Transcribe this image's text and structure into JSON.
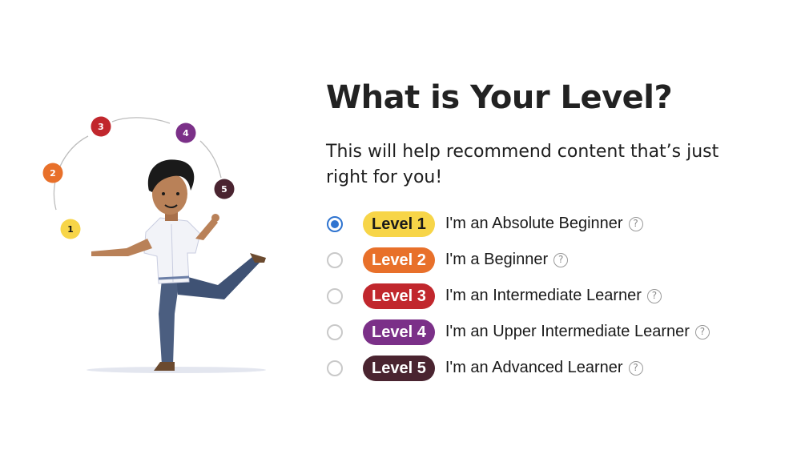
{
  "header": {
    "title": "What is Your Level?",
    "subtitle": "This will help recommend content that’s just right for you!"
  },
  "illustration": {
    "icon": "juggling-person-illustration",
    "balls": [
      {
        "label": "1",
        "color": "#f7d548"
      },
      {
        "label": "2",
        "color": "#e8702a"
      },
      {
        "label": "3",
        "color": "#c1272d"
      },
      {
        "label": "4",
        "color": "#7b3088"
      },
      {
        "label": "5",
        "color": "#4a2430"
      }
    ]
  },
  "levels": [
    {
      "badge": "Level 1",
      "label": "I'm an Absolute Beginner",
      "color": "#f7d548",
      "text_color": "#1a1a1a",
      "selected": true,
      "help": "?"
    },
    {
      "badge": "Level 2",
      "label": "I'm a Beginner",
      "color": "#e8702a",
      "text_color": "#ffffff",
      "selected": false,
      "help": "?"
    },
    {
      "badge": "Level 3",
      "label": "I'm an Intermediate Learner",
      "color": "#c1272d",
      "text_color": "#ffffff",
      "selected": false,
      "help": "?"
    },
    {
      "badge": "Level 4",
      "label": "I'm an Upper Intermediate Learner",
      "color": "#7b3088",
      "text_color": "#ffffff",
      "selected": false,
      "help": "?"
    },
    {
      "badge": "Level 5",
      "label": "I'm an Advanced Learner",
      "color": "#4a2430",
      "text_color": "#ffffff",
      "selected": false,
      "help": "?"
    }
  ]
}
